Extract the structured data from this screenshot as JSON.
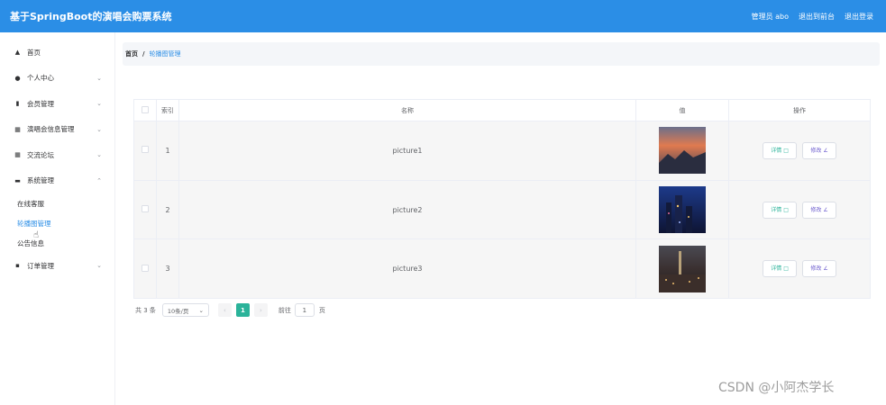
{
  "header": {
    "title": "基于SpringBoot的演唱会购票系统",
    "admin_label": "管理员 abo",
    "backend_link": "退出到前台",
    "logout_link": "退出登录"
  },
  "sidebar": {
    "items": [
      {
        "label": "首页",
        "icon": "home-icon"
      },
      {
        "label": "个人中心",
        "icon": "user-icon"
      },
      {
        "label": "会员管理",
        "icon": "chart-icon"
      },
      {
        "label": "演唱会信息管理",
        "icon": "clipboard-icon"
      },
      {
        "label": "交流论坛",
        "icon": "grid-icon"
      },
      {
        "label": "系统管理",
        "icon": "briefcase-icon"
      }
    ],
    "sub_items": [
      {
        "label": "在线客服"
      },
      {
        "label": "轮播图管理"
      },
      {
        "label": "公告信息"
      }
    ],
    "last_item": {
      "label": "订单管理",
      "icon": "chat-icon"
    }
  },
  "breadcrumb": {
    "home": "首页",
    "separator": "/",
    "current": "轮播图管理"
  },
  "table": {
    "headers": [
      "索引",
      "名称",
      "值",
      "操作"
    ],
    "rows": [
      {
        "index": "1",
        "name": "picture1"
      },
      {
        "index": "2",
        "name": "picture2"
      },
      {
        "index": "3",
        "name": "picture3"
      }
    ],
    "detail_label": "详情",
    "edit_label": "修改"
  },
  "pagination": {
    "total": "共 3 条",
    "page_size": "10条/页",
    "current_page": "1",
    "goto_label": "前往",
    "goto_value": "1",
    "page_word": "页"
  },
  "watermark": "CSDN @小阿杰学长"
}
